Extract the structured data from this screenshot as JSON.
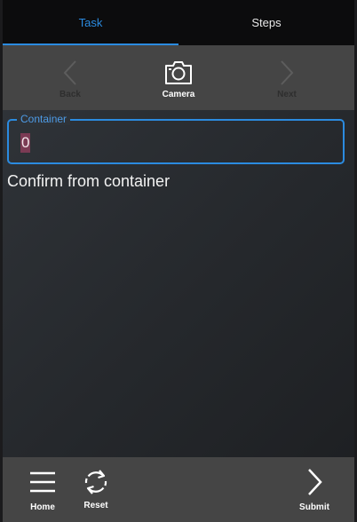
{
  "tabs": {
    "task_label": "Task",
    "steps_label": "Steps",
    "active": "Task"
  },
  "toolbar": {
    "back_label": "Back",
    "camera_label": "Camera",
    "next_label": "Next",
    "back_icon": "chevron-left-icon",
    "camera_icon": "camera-icon",
    "next_icon": "chevron-right-icon"
  },
  "form": {
    "container_label": "Container",
    "container_value": "0"
  },
  "message": {
    "text": "Confirm from container"
  },
  "bottom": {
    "home_label": "Home",
    "reset_label": "Reset",
    "submit_label": "Submit",
    "home_icon": "hamburger-menu-icon",
    "reset_icon": "refresh-icon",
    "submit_icon": "chevron-right-icon"
  },
  "colors": {
    "accent": "#2b8be0",
    "bar_background": "#454545",
    "tabbar_background": "#0c0c0d",
    "selection": "#7b3b54"
  }
}
